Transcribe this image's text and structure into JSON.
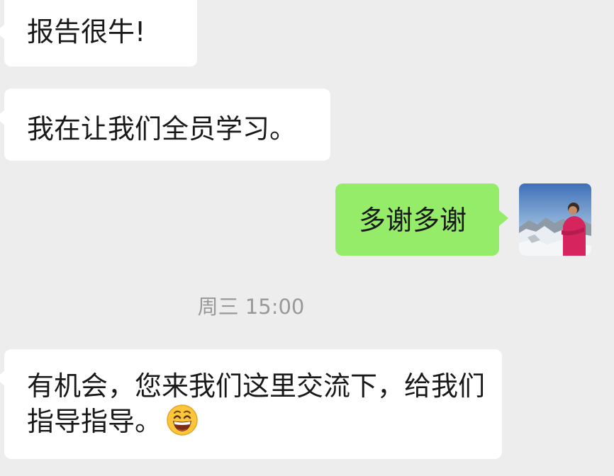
{
  "messages": [
    {
      "direction": "incoming",
      "text": "报告很牛!"
    },
    {
      "direction": "incoming",
      "text": "我在让我们全员学习。"
    },
    {
      "direction": "outgoing",
      "text": "多谢多谢"
    },
    {
      "direction": "incoming",
      "text": "有机会，您来我们这里交流下，给我们指导指导。",
      "emoji": "grinning-face-emoji"
    }
  ],
  "timestamp": "周三 15:00",
  "colors": {
    "background": "#ededed",
    "incoming_bubble": "#ffffff",
    "outgoing_bubble": "#95ec69",
    "text": "#191919",
    "timestamp": "#999999"
  },
  "avatar": {
    "icon": "user-avatar-photo"
  }
}
